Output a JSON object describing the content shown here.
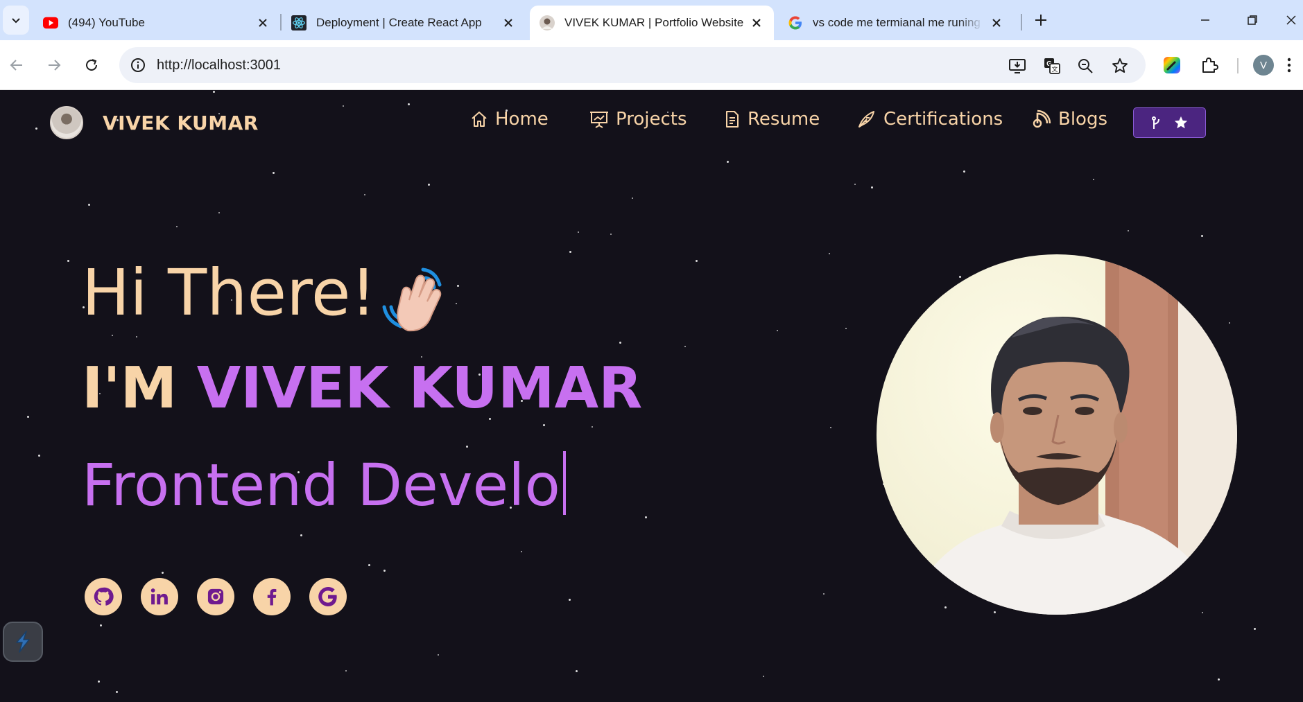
{
  "browser": {
    "tabs": [
      {
        "title": "(494) YouTube",
        "favicon": "youtube-icon",
        "active": false
      },
      {
        "title": "Deployment | Create React App",
        "favicon": "react-icon",
        "active": false
      },
      {
        "title": "VIVEK KUMAR | Portfolio Website",
        "favicon": "portrait-favicon",
        "active": true
      },
      {
        "title": "vs code me termianal me runing p",
        "favicon": "google-icon",
        "active": false
      }
    ],
    "url": "http://localhost:3001",
    "profile_initial": "V"
  },
  "site": {
    "brand": "VIVEK KUMAR",
    "nav": [
      {
        "label": "Home",
        "icon": "home-icon"
      },
      {
        "label": "Projects",
        "icon": "presentation-icon"
      },
      {
        "label": "Resume",
        "icon": "document-icon"
      },
      {
        "label": "Certifications",
        "icon": "quill-pen-icon"
      },
      {
        "label": "Blogs",
        "icon": "blog-rss-icon"
      }
    ],
    "fork_button_icons": [
      "git-fork-icon",
      "star-icon"
    ],
    "hero": {
      "greeting": "Hi There!",
      "name_prefix": "I'M",
      "name": "VIVEK KUMAR",
      "typewriter": "Frontend Develo"
    },
    "socials": [
      "github-icon",
      "linkedin-icon",
      "instagram-icon",
      "facebook-icon",
      "google-icon"
    ],
    "colors": {
      "background": "#13111a",
      "accent_peach": "#f8d4a8",
      "accent_purple": "#c770f0",
      "fork_button": "#4b2580"
    }
  }
}
